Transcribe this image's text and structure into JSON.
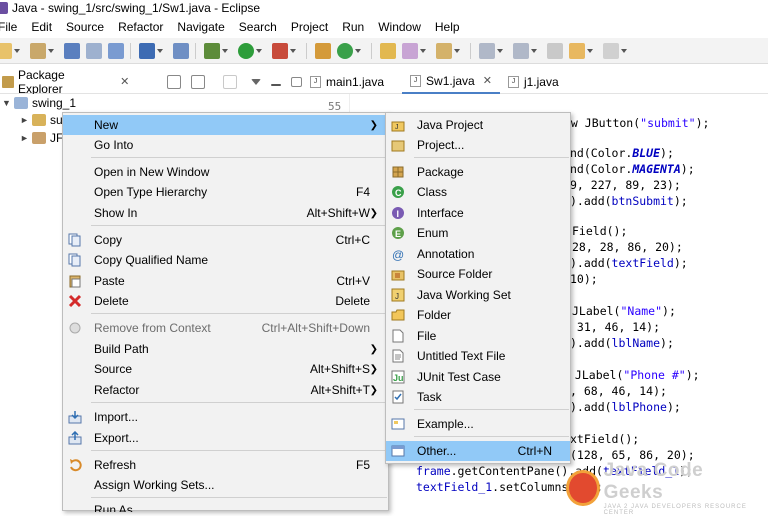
{
  "window": {
    "title": "Java - swing_1/src/swing_1/Sw1.java - Eclipse"
  },
  "menubar": [
    "File",
    "Edit",
    "Source",
    "Refactor",
    "Navigate",
    "Search",
    "Project",
    "Run",
    "Window",
    "Help"
  ],
  "package_explorer": {
    "tab_label": "Package Explorer",
    "close_glyph": "✕",
    "tree": [
      {
        "label": "swing_1",
        "expanded": true
      },
      {
        "label": "su"
      },
      {
        "label": "JF"
      }
    ]
  },
  "editor": {
    "tabs": [
      {
        "label": "main1.java",
        "active": false
      },
      {
        "label": "Sw1.java",
        "active": true
      },
      {
        "label": "j1.java",
        "active": false
      }
    ],
    "line_number": "55",
    "code": [
      "ew JButton(\"submit\");",
      "nd(Color.BLUE);",
      "nd(Color.MAGENTA);",
      "9, 227, 89, 23);",
      ").add(btnSubmit);",
      "Field();",
      "28, 28, 86, 20);",
      ").add(textField);",
      "10);",
      "JLabel(\"Name\");",
      " 31, 46, 14);",
      ").add(lblName);",
      " JLabel(\"Phone #\");",
      ", 68, 46, 14);",
      ").add(lblPhone);",
      "xtField();",
      "(128, 65, 86, 20);",
      "frame.getContentPane().add(textField_1);",
      "textField_1.setColumns(10);"
    ]
  },
  "context_menu": {
    "items": [
      {
        "label": "New",
        "submenu": true,
        "highlighted": true
      },
      {
        "label": "Go Into"
      },
      {
        "label": "Open in New Window"
      },
      {
        "label": "Open Type Hierarchy",
        "shortcut": "F4"
      },
      {
        "label": "Show In",
        "shortcut": "Alt+Shift+W",
        "submenu": true
      },
      {
        "label": "Copy",
        "shortcut": "Ctrl+C",
        "icon": "copy-icon"
      },
      {
        "label": "Copy Qualified Name",
        "icon": "copy-qualified-icon"
      },
      {
        "label": "Paste",
        "shortcut": "Ctrl+V",
        "icon": "paste-icon"
      },
      {
        "label": "Delete",
        "shortcut": "Delete",
        "icon": "delete-icon"
      },
      {
        "label": "Remove from Context",
        "shortcut": "Ctrl+Alt+Shift+Down",
        "disabled": true,
        "icon": "remove-context-icon"
      },
      {
        "label": "Build Path",
        "submenu": true
      },
      {
        "label": "Source",
        "shortcut": "Alt+Shift+S",
        "submenu": true
      },
      {
        "label": "Refactor",
        "shortcut": "Alt+Shift+T",
        "submenu": true
      },
      {
        "label": "Import...",
        "icon": "import-icon"
      },
      {
        "label": "Export...",
        "icon": "export-icon"
      },
      {
        "label": "Refresh",
        "shortcut": "F5",
        "icon": "refresh-icon"
      },
      {
        "label": "Assign Working Sets..."
      },
      {
        "label": "Run As"
      }
    ]
  },
  "new_submenu": {
    "items": [
      {
        "label": "Java Project",
        "icon": "java-project-icon"
      },
      {
        "label": "Project...",
        "icon": "project-icon"
      },
      {
        "label": "Package",
        "icon": "package-icon"
      },
      {
        "label": "Class",
        "icon": "class-icon"
      },
      {
        "label": "Interface",
        "icon": "interface-icon"
      },
      {
        "label": "Enum",
        "icon": "enum-icon"
      },
      {
        "label": "Annotation",
        "icon": "annotation-icon"
      },
      {
        "label": "Source Folder",
        "icon": "source-folder-icon"
      },
      {
        "label": "Java Working Set",
        "icon": "working-set-icon"
      },
      {
        "label": "Folder",
        "icon": "folder-icon"
      },
      {
        "label": "File",
        "icon": "file-icon"
      },
      {
        "label": "Untitled Text File",
        "icon": "text-file-icon"
      },
      {
        "label": "JUnit Test Case",
        "icon": "junit-icon"
      },
      {
        "label": "Task",
        "icon": "task-icon"
      },
      {
        "label": "Example...",
        "icon": "example-icon"
      },
      {
        "label": "Other...",
        "shortcut": "Ctrl+N",
        "highlighted": true,
        "icon": "other-icon"
      }
    ]
  },
  "watermark": {
    "title": "Java Code Geeks",
    "subtitle": "JAVA 2 JAVA DEVELOPERS RESOURCE CENTER"
  },
  "colors": {
    "highlight": "#91c9f7",
    "menu_bg": "#f2f2f2",
    "keyword": "#7f0055",
    "string": "#2a00ff",
    "field": "#0000c0"
  }
}
